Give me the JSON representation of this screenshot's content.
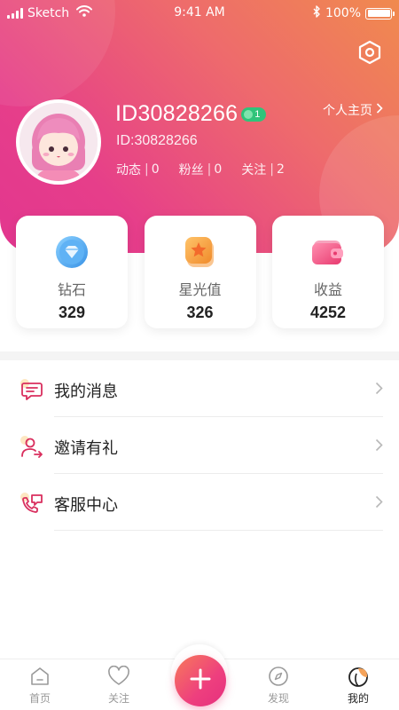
{
  "status_bar": {
    "carrier": "Sketch",
    "time": "9:41 AM",
    "battery": "100%"
  },
  "profile": {
    "username": "ID30828266",
    "level": "1",
    "user_id": "ID:30828266",
    "profile_link": "个人主页",
    "stats": [
      {
        "label": "动态",
        "value": "0"
      },
      {
        "label": "粉丝",
        "value": "0"
      },
      {
        "label": "关注",
        "value": "2"
      }
    ]
  },
  "cards": [
    {
      "label": "钻石",
      "value": "329",
      "icon": "diamond-icon"
    },
    {
      "label": "星光值",
      "value": "326",
      "icon": "star-icon"
    },
    {
      "label": "收益",
      "value": "4252",
      "icon": "wallet-icon"
    }
  ],
  "menu": [
    {
      "label": "我的消息",
      "icon": "message-icon"
    },
    {
      "label": "邀请有礼",
      "icon": "invite-user-icon"
    },
    {
      "label": "客服中心",
      "icon": "customer-service-icon"
    }
  ],
  "tabbar": {
    "tabs": [
      {
        "label": "首页",
        "icon": "home-icon"
      },
      {
        "label": "关注",
        "icon": "heart-icon"
      },
      {
        "label": "发现",
        "icon": "compass-icon"
      },
      {
        "label": "我的",
        "icon": "profile-tab-icon"
      }
    ],
    "active_index": 3,
    "fab_icon": "plus-icon"
  },
  "colors": {
    "header_gradient": [
      "#f08a4e",
      "#ee6b6c",
      "#e2368f"
    ],
    "accent": "#ee3f7e",
    "level_badge": "#2fc47a"
  }
}
